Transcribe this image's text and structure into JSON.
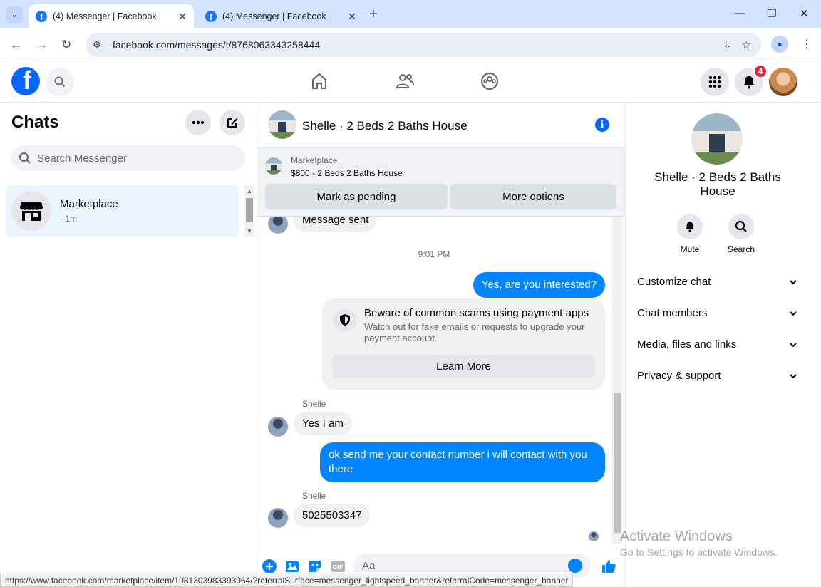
{
  "browser": {
    "tabs": [
      {
        "title": "(4) Messenger | Facebook",
        "active": true
      },
      {
        "title": "(4) Messenger | Facebook",
        "active": false
      }
    ],
    "url": "facebook.com/messages/t/8768063343258444",
    "status_url": "https://www.facebook.com/marketplace/item/1081303983393064/?referralSurface=messenger_lightspeed_banner&referralCode=messenger_banner"
  },
  "header": {
    "notification_count": "4"
  },
  "left": {
    "title": "Chats",
    "search_placeholder": "Search Messenger",
    "chats": [
      {
        "name": "Marketplace",
        "meta": "· 1m"
      }
    ]
  },
  "conversation": {
    "title": "Shelle · 2 Beds 2 Baths House",
    "marketplace_label": "Marketplace",
    "listing": "$800 - 2 Beds 2 Baths House",
    "mark_pending": "Mark as pending",
    "more_options": "More options",
    "partial_message": "Message sent",
    "timestamp": "9:01 PM",
    "out_msg_1": "Yes, are you interested?",
    "scam_title": "Beware of common scams using payment apps",
    "scam_body": "Watch out for fake emails or requests to upgrade your payment account.",
    "learn_more": "Learn More",
    "sender_1": "Shelle",
    "in_msg_1": "Yes I am",
    "out_msg_2": "ok send me your contact number i will contact with you there",
    "sender_2": "Shelle",
    "in_msg_2": "5025503347",
    "composer_placeholder": "Aa"
  },
  "right": {
    "title": "Shelle · 2 Beds 2 Baths House",
    "mute": "Mute",
    "search": "Search",
    "sections": [
      "Customize chat",
      "Chat members",
      "Media, files and links",
      "Privacy & support"
    ]
  },
  "watermark": {
    "line1": "Activate Windows",
    "line2": "Go to Settings to activate Windows."
  },
  "colors": {
    "brand": "#0866ff",
    "outgoing": "#0084ff",
    "badge": "#e41e3f"
  }
}
